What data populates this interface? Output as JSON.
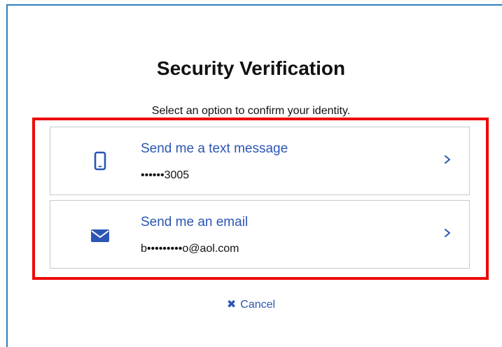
{
  "page": {
    "title": "Security Verification",
    "subtitle": "Select an option to confirm your identity."
  },
  "options": [
    {
      "label": "Send me a text message",
      "detail": "••••••3005",
      "icon": "mobile-phone-icon"
    },
    {
      "label": "Send me an email",
      "detail": "b•••••••••o@aol.com",
      "icon": "envelope-icon"
    }
  ],
  "cancel": {
    "icon_glyph": "✖",
    "label": "Cancel"
  },
  "colors": {
    "accent": "#2b56b5",
    "highlight": "#ee0a0a",
    "frame": "#2d7fc1"
  }
}
